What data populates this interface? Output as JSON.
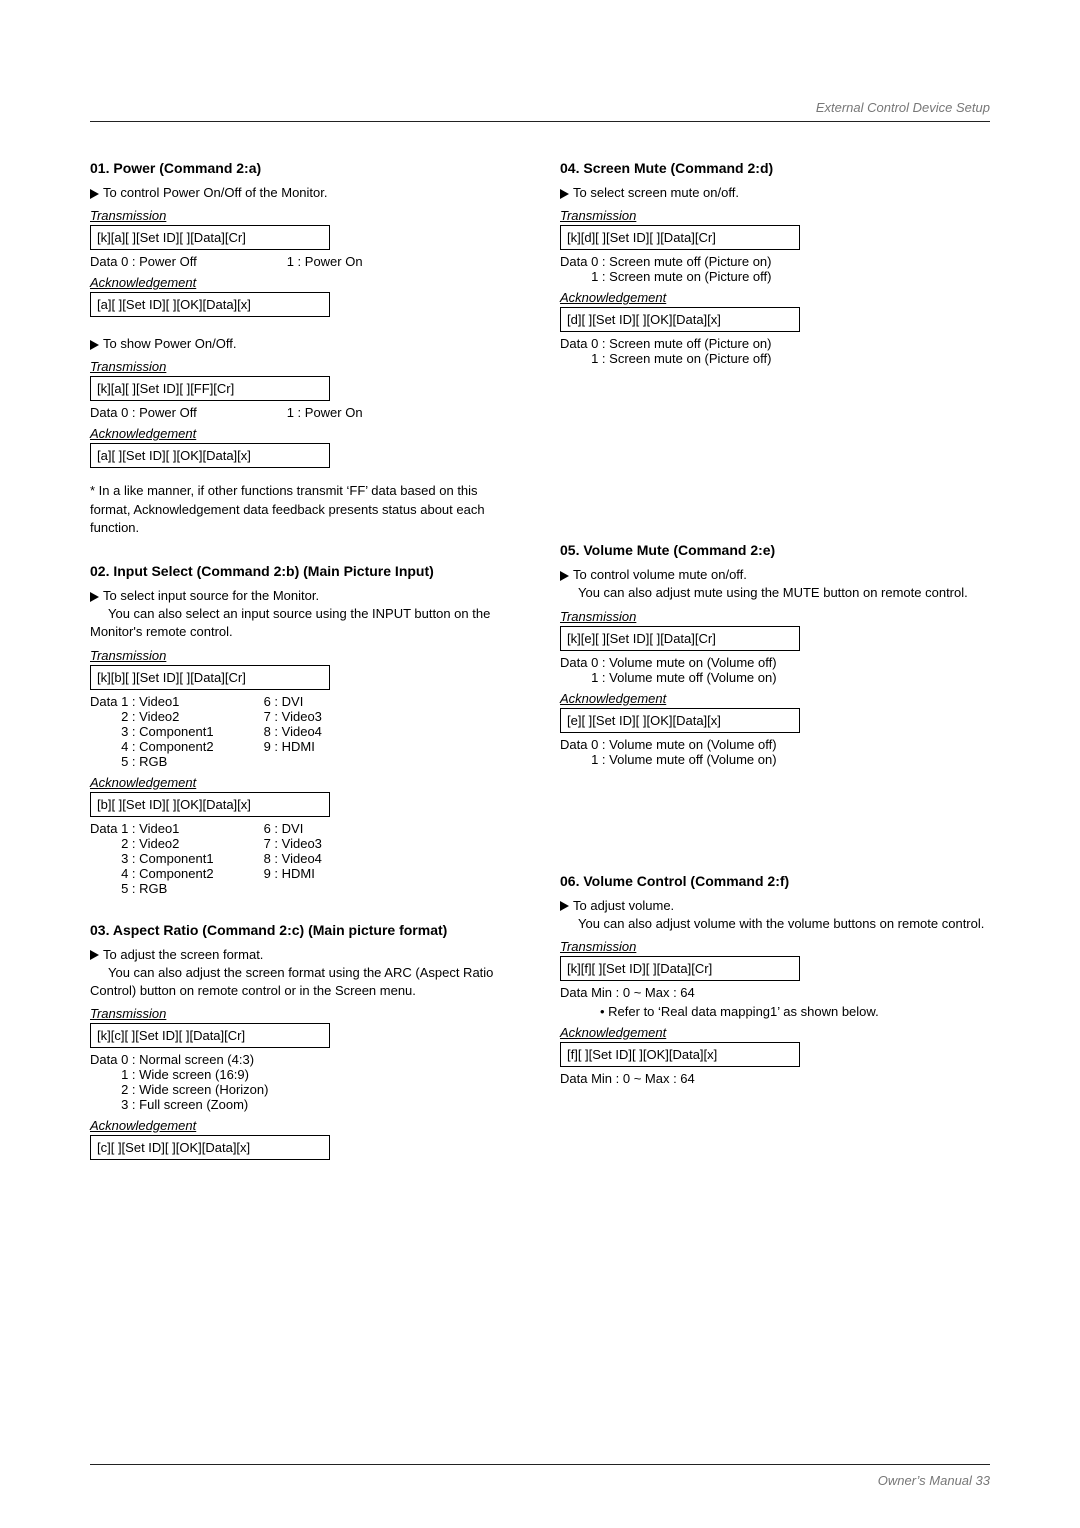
{
  "header": {
    "right": "External Control Device Setup"
  },
  "left": {
    "s01": {
      "title": "01. Power (Command 2:a)",
      "d1": "To control Power On/Off of the Monitor.",
      "tLabel": "Transmission",
      "tBox": "[k][a][  ][Set ID][  ][Data][Cr]",
      "data_left": "Data  0  : Power Off",
      "data_right": "1  : Power On",
      "aLabel": "Acknowledgement",
      "aBox": "[a][  ][Set ID][  ][OK][Data][x]",
      "d2": "To show Power On/Off.",
      "tLabel2": "Transmission",
      "tBox2": "[k][a][  ][Set ID][  ][FF][Cr]",
      "data2_left": "Data  0  : Power Off",
      "data2_right": "1  : Power On",
      "aLabel2": "Acknowledgement",
      "aBox2": "[a][  ][Set ID][  ][OK][Data][x]",
      "note": "* In a like manner, if other functions transmit ‘FF’ data based on this format, Acknowledgement data feedback presents status about each function."
    },
    "s02": {
      "title": "02. Input Select (Command 2:b) (Main Picture Input)",
      "d1a": "To select input source for the Monitor.",
      "d1b": "You can also select an input source using the INPUT button on the Monitor's remote control.",
      "tLabel": "Transmission",
      "tBox": "[k][b][  ][Set ID][  ][Data][Cr]",
      "g1_head": "Data",
      "g1c1": [
        "1  : Video1",
        "2  : Video2",
        "3  : Component1",
        "4  : Component2",
        "5  : RGB"
      ],
      "g1c2": [
        "6  : DVI",
        "7  : Video3",
        "8  : Video4",
        "9  : HDMI"
      ],
      "aLabel": "Acknowledgement",
      "aBox": "[b][  ][Set ID][  ][OK][Data][x]",
      "g2_head": "Data",
      "g2c1": [
        "1  : Video1",
        "2  : Video2",
        "3  : Component1",
        "4  : Component2",
        "5  : RGB"
      ],
      "g2c2": [
        "6  : DVI",
        "7  : Video3",
        "8  : Video4",
        "9  : HDMI"
      ]
    },
    "s03": {
      "title": "03. Aspect Ratio (Command 2:c) (Main picture format)",
      "d1a": "To adjust the screen format.",
      "d1b": "You can also adjust the screen format using the ARC (Aspect Ratio Control) button on remote control or in the Screen menu.",
      "tLabel": "Transmission",
      "tBox": "[k][c][  ][Set ID][  ][Data][Cr]",
      "list_head": "Data",
      "list": [
        "0   :  Normal screen (4:3)",
        "1   :  Wide screen (16:9)",
        "2   :  Wide screen (Horizon)",
        "3   :  Full screen (Zoom)"
      ],
      "aLabel": "Acknowledgement",
      "aBox": "[c][  ][Set ID][  ][OK][Data][x]"
    }
  },
  "right": {
    "s04": {
      "title": "04. Screen Mute (Command 2:d)",
      "d1": "To select screen mute on/off.",
      "tLabel": "Transmission",
      "tBox": "[k][d][  ][Set ID][  ][Data][Cr]",
      "data_head": "Data",
      "data1": "0  :  Screen mute off (Picture on)",
      "data2": "1  :  Screen mute on (Picture off)",
      "aLabel": "Acknowledgement",
      "aBox": "[d][  ][Set ID][  ][OK][Data][x]",
      "data3_head": "Data",
      "data3": "0  :  Screen mute off (Picture on)",
      "data4": "1  :  Screen mute on (Picture off)"
    },
    "s05": {
      "title": "05. Volume Mute (Command 2:e)",
      "d1a": "To control volume mute on/off.",
      "d1b": "You can also adjust mute using the MUTE button on remote control.",
      "tLabel": "Transmission",
      "tBox": "[k][e][  ][Set ID][  ][Data][Cr]",
      "data_head": "Data",
      "data1": "0  :  Volume mute on (Volume off)",
      "data2": "1  :  Volume mute off (Volume on)",
      "aLabel": "Acknowledgement",
      "aBox": "[e][  ][Set ID][  ][OK][Data][x]",
      "data3_head": "Data",
      "data3": "0  :  Volume mute on (Volume off)",
      "data4": "1  :  Volume mute off (Volume on)"
    },
    "s06": {
      "title": "06. Volume Control (Command 2:f)",
      "d1a": "To adjust volume.",
      "d1b": "You can also adjust volume with the volume buttons on remote control.",
      "tLabel": "Transmission",
      "tBox": "[k][f][  ][Set ID][  ][Data][Cr]",
      "data1": "Data   Min : 0 ~ Max : 64",
      "bullet": "• Refer to ‘Real data mapping1’ as shown below.",
      "aLabel": "Acknowledgement",
      "aBox": "[f][  ][Set ID][  ][OK][Data][x]",
      "data2": "Data   Min : 0 ~ Max : 64"
    }
  },
  "footer": {
    "text": "Owner’s Manual   33"
  }
}
